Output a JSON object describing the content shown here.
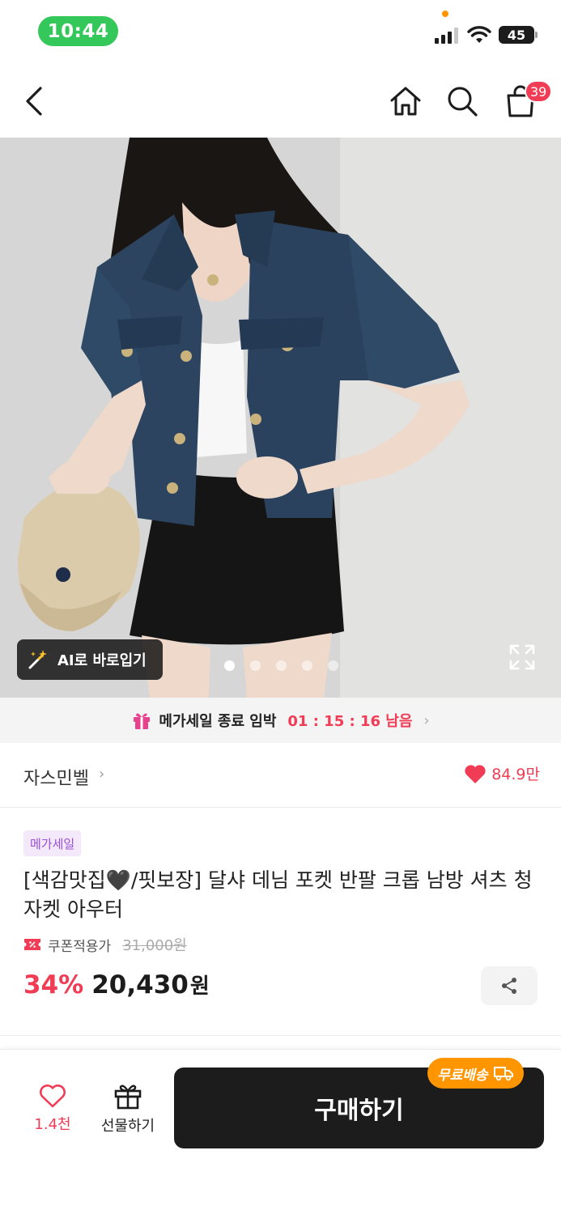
{
  "status_bar": {
    "time": "10:44",
    "battery": "45"
  },
  "nav": {
    "cart_count": "39"
  },
  "image": {
    "ai_button_label": "AI로 바로입기",
    "carousel_total": 5,
    "carousel_active": 1
  },
  "sale_banner": {
    "label": "메가세일 종료 임박",
    "timer": "01 : 15 : 16 남음"
  },
  "store": {
    "name": "자스민벨",
    "likes": "84.9만"
  },
  "product": {
    "badge": "메가세일",
    "title": "[색감맛집🖤/핏보장] 달샤 데님 포켓 반팔 크롭 남방 셔츠 청자켓 아우터",
    "coupon_label": "쿠폰적용가",
    "original_price": "31,000원",
    "discount": "34%",
    "price": "20,430",
    "currency": "원"
  },
  "bottom_bar": {
    "wish_count": "1.4천",
    "gift_label": "선물하기",
    "buy_label": "구매하기",
    "free_shipping_label": "무료배송"
  },
  "colors": {
    "accent": "#f03c55",
    "status_green": "#34c759",
    "badge_purple": "#9a4fd3",
    "shipping_orange": "#ff9500"
  }
}
